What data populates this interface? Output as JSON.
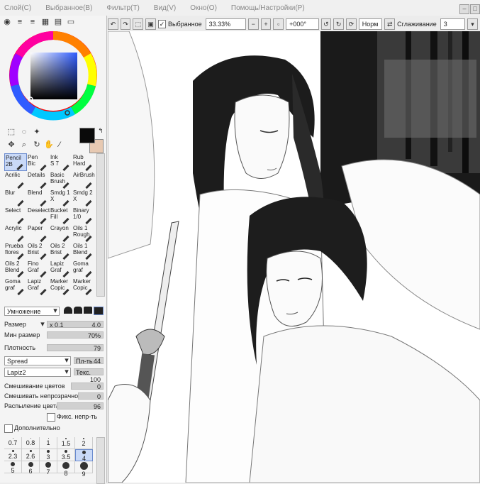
{
  "menu": [
    "Слой(C)",
    "Выбранное(B)",
    "Фильтр(T)",
    "Вид(V)",
    "Окно(O)",
    "Помощь/Настройки(P)"
  ],
  "window_buttons": [
    "–",
    "□"
  ],
  "toolbar": {
    "selection_label": "Выбранное",
    "zoom": "33.33%",
    "rotation": "+000°",
    "mode": "Норм",
    "smoothing_label": "Сглаживание",
    "smoothing_value": "3"
  },
  "brushes": [
    {
      "label": "Pencil\n2B",
      "selected": true
    },
    {
      "label": "Pen\nBic",
      "selected": false
    },
    {
      "label": "Ink\nS 7",
      "selected": false
    },
    {
      "label": "Rub\nHard",
      "selected": false
    },
    {
      "label": "Acrilic",
      "selected": false
    },
    {
      "label": "Details",
      "selected": false
    },
    {
      "label": "Basic\nBrush",
      "selected": false
    },
    {
      "label": "AirBrush",
      "selected": false
    },
    {
      "label": "Blur",
      "selected": false
    },
    {
      "label": "Blend",
      "selected": false
    },
    {
      "label": "Smdg 1\nX",
      "selected": false
    },
    {
      "label": "Smdg 2\nX",
      "selected": false
    },
    {
      "label": "Select",
      "selected": false
    },
    {
      "label": "Deselect",
      "selected": false
    },
    {
      "label": "Bucket\nFill",
      "selected": false
    },
    {
      "label": "Binary\n1/0",
      "selected": false
    },
    {
      "label": "Acrylic",
      "selected": false
    },
    {
      "label": "Paper",
      "selected": false
    },
    {
      "label": "Crayon",
      "selected": false
    },
    {
      "label": "Oils 1\nRough",
      "selected": false
    },
    {
      "label": "Prueba\nflores",
      "selected": false
    },
    {
      "label": "Oils 2\nBrist",
      "selected": false
    },
    {
      "label": "Oils 2\nBrist",
      "selected": false
    },
    {
      "label": "Oils 1\nBlend",
      "selected": false
    },
    {
      "label": "Oils 2\nBlend",
      "selected": false
    },
    {
      "label": "Fino\nGraf",
      "selected": false
    },
    {
      "label": "Lapiz\nGraf",
      "selected": false
    },
    {
      "label": "Goma\ngraf",
      "selected": false
    },
    {
      "label": "Goma\ngraf",
      "selected": false
    },
    {
      "label": "Lapiz\nGraf",
      "selected": false
    },
    {
      "label": "Marker\nCopic",
      "selected": false
    },
    {
      "label": "Marker\nCopic",
      "selected": false
    }
  ],
  "blend_mode": "Умножение",
  "settings": {
    "size_label": "Размер",
    "size_mult": "x 0.1",
    "size_value": "4.0",
    "min_size_label": "Мин размер",
    "min_size_value": "70%",
    "density_label": "Плотность",
    "density_value": "79",
    "spread": "Spread",
    "spread_setting": "Пл-ть",
    "spread_value": "44",
    "texture": "Lapiz2",
    "texture_setting": "Текс.",
    "texture_value": "100",
    "color_mix_label": "Смешивание цветов",
    "color_mix_value": "0",
    "opacity_mix_label": "Смешивать непрозрачность",
    "opacity_mix_value": "0",
    "color_spray_label": "Распыление цвета",
    "color_spray_value": "96",
    "fix_opacity_label": "Фикс. непр-ть",
    "advanced_label": "Дополнительно"
  },
  "size_rows": [
    [
      "0.7",
      "0.8",
      "1",
      "1.5",
      "2"
    ],
    [
      "2.3",
      "2.6",
      "3",
      "3.5",
      "4"
    ],
    [
      "5",
      "6",
      "7",
      "8",
      "9"
    ]
  ],
  "selected_size": "4",
  "colors": {
    "primary": "#0a0a0a",
    "secondary": "#e7c9b2",
    "accent": "#6a8acd"
  }
}
